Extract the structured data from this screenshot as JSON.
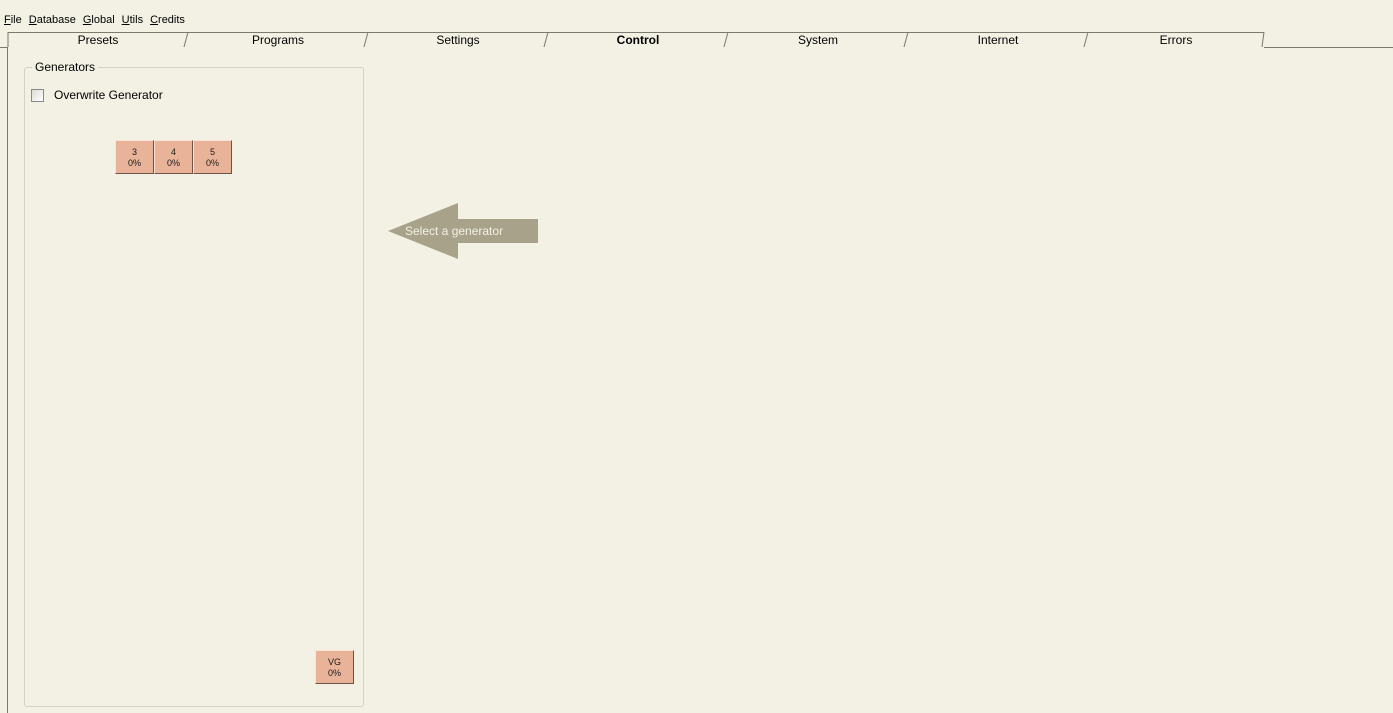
{
  "menu": [
    {
      "mnemonic": "F",
      "rest": "ile"
    },
    {
      "mnemonic": "D",
      "rest": "atabase"
    },
    {
      "mnemonic": "G",
      "rest": "lobal"
    },
    {
      "mnemonic": "U",
      "rest": "tils"
    },
    {
      "mnemonic": "C",
      "rest": "redits"
    }
  ],
  "tabs": [
    {
      "label": "Presets"
    },
    {
      "label": "Programs"
    },
    {
      "label": "Settings"
    },
    {
      "label": "Control",
      "active": true
    },
    {
      "label": "System"
    },
    {
      "label": "Internet"
    },
    {
      "label": "Errors"
    }
  ],
  "generators": {
    "title": "Generators",
    "overwrite_label": "Overwrite Generator",
    "overwrite_checked": false,
    "buttons": [
      {
        "id": "3",
        "load": "0%"
      },
      {
        "id": "4",
        "load": "0%"
      },
      {
        "id": "5",
        "load": "0%"
      }
    ],
    "virtual": {
      "id": "VG",
      "load": "0%"
    }
  },
  "hint": {
    "text": "Select a generator"
  },
  "colors": {
    "background": "#f2f1e3",
    "generator_button": "#e9b39a",
    "hint_arrow": "#a8a28a"
  }
}
